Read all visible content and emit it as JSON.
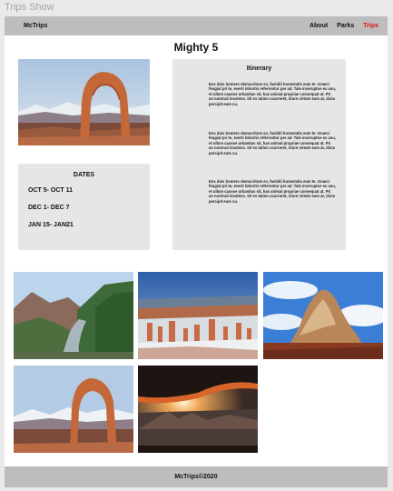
{
  "window": {
    "title": "Trips Show"
  },
  "nav": {
    "brand": "McTrips",
    "links": [
      {
        "label": "About"
      },
      {
        "label": "Parks"
      },
      {
        "label": "Trips"
      }
    ],
    "active_color": "#e11414"
  },
  "page": {
    "title": "Mighty 5"
  },
  "dates": {
    "title": "DATES",
    "items": [
      "OCT 5- OCT 11",
      "DEC 1- DEC 7",
      "JAN 15- JAN21"
    ]
  },
  "itinerary": {
    "title": "Itinerary",
    "paragraphs": [
      "Eos duis homero democritum ex, fastidii honestatis eum te. Graeci feugiat pri te, everti lobortis referrentur per ad. Tale inceruptoe ex usu, et ullum causse urbanitas sit, has animal propriae consequat at. Pri an nostrud insolens. Sit ex tation ocurreret, iriure virtute eum at, dicta percipit eum cu.",
      "Eos duis homero democritum ex, fastidii honestatis eum te. Graeci feugiat pri te, everti lobortis referrentur per ad. Tale inceruptoe ex usu, et ullum causse urbanitas sit, has animal propriae consequat at. Pri an nostrud insolens. Sit ex tation ocurreret, iriure virtute eum at, dicta percipit eum cu.",
      "Eos duis homero democritum ex, fastidii honestatis eum te. Graeci feugiat pri te, everti lobortis referrentur per ad. Tale inceruptoe ex usu, et ullum causse urbanitas sit, has animal propriae consequat at. Pri an nostrud insolens. Sit ex tation ocurreret, iriure virtute eum at, dicta percipit eum cu."
    ]
  },
  "gallery": [
    {
      "icon": "canyon-river-photo"
    },
    {
      "icon": "hoodoo-amphitheater-photo"
    },
    {
      "icon": "sandstone-butte-photo"
    },
    {
      "icon": "delicate-arch-photo"
    },
    {
      "icon": "mesa-arch-sunrise-photo"
    }
  ],
  "footer": {
    "text": "McTrips©2020"
  }
}
